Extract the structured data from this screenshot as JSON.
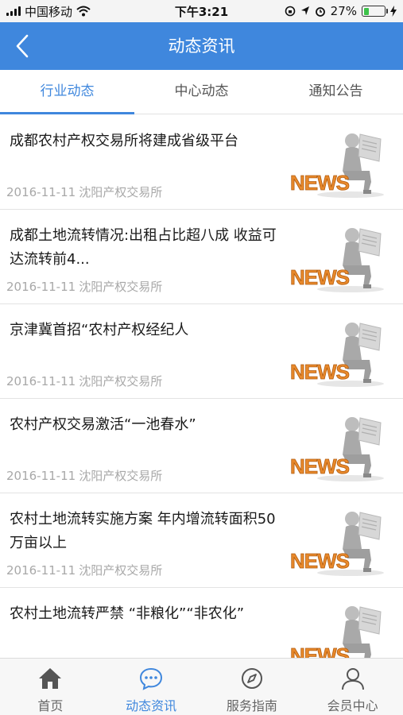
{
  "status_bar": {
    "carrier": "中国移动",
    "time": "下午3:21",
    "battery": "27%",
    "battery_level": 0.27,
    "icons": [
      "signal-icon",
      "wifi-icon",
      "orientation-lock-icon",
      "location-icon",
      "alarm-icon",
      "battery-icon",
      "charging-icon"
    ]
  },
  "nav": {
    "title": "动态资讯",
    "back_icon": "back-chevron-icon"
  },
  "tabs": [
    {
      "label": "行业动态",
      "active": true
    },
    {
      "label": "中心动态",
      "active": false
    },
    {
      "label": "通知公告",
      "active": false
    }
  ],
  "news": [
    {
      "title": "成都农村产权交易所将建成省级平台",
      "date": "2016-11-11",
      "source": "沈阳产权交易所",
      "thumb": "news-reader-image"
    },
    {
      "title": "成都土地流转情况:出租占比超八成 收益可达流转前4...",
      "date": "2016-11-11",
      "source": "沈阳产权交易所",
      "thumb": "news-reader-image"
    },
    {
      "title": "京津冀首招“农村产权经纪人",
      "date": "2016-11-11",
      "source": "沈阳产权交易所",
      "thumb": "news-reader-image"
    },
    {
      "title": "农村产权交易激活“一池春水”",
      "date": "2016-11-11",
      "source": "沈阳产权交易所",
      "thumb": "news-reader-image"
    },
    {
      "title": "农村土地流转实施方案 年内增流转面积50万亩以上",
      "date": "2016-11-11",
      "source": "沈阳产权交易所",
      "thumb": "news-reader-image"
    },
    {
      "title": "农村土地流转严禁 “非粮化”“非农化”",
      "date": "",
      "source": "",
      "thumb": "news-reader-image"
    }
  ],
  "tabbar": [
    {
      "label": "首页",
      "icon": "home-icon",
      "active": false
    },
    {
      "label": "动态资讯",
      "icon": "chat-bubble-icon",
      "active": true
    },
    {
      "label": "服务指南",
      "icon": "compass-icon",
      "active": false
    },
    {
      "label": "会员中心",
      "icon": "user-icon",
      "active": false
    }
  ],
  "colors": {
    "primary": "#3f87dd",
    "news_orange": "#e8892b"
  }
}
